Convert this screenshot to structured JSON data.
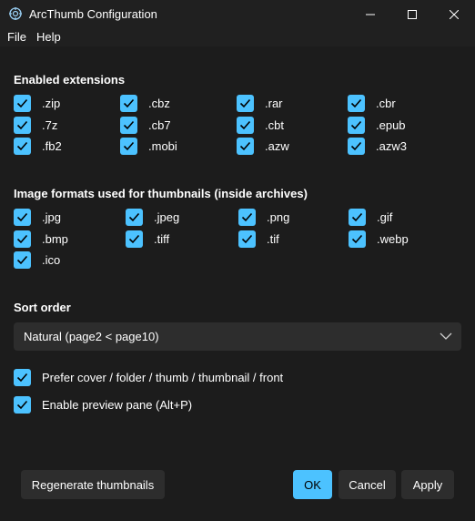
{
  "window": {
    "title": "ArcThumb Configuration",
    "icons": [
      "app-icon",
      "minimize-icon",
      "maximize-icon",
      "close-icon"
    ]
  },
  "menu": {
    "file": "File",
    "help": "Help"
  },
  "extensions": {
    "heading": "Enabled extensions",
    "items": [
      ".zip",
      ".cbz",
      ".rar",
      ".cbr",
      ".7z",
      ".cb7",
      ".cbt",
      ".epub",
      ".fb2",
      ".mobi",
      ".azw",
      ".azw3"
    ],
    "checked": true
  },
  "image_formats": {
    "heading": "Image formats used for thumbnails (inside archives)",
    "items": [
      ".jpg",
      ".jpeg",
      ".png",
      ".gif",
      ".bmp",
      ".tiff",
      ".tif",
      ".webp",
      ".ico"
    ],
    "checked": true
  },
  "sort": {
    "heading": "Sort order",
    "selected": "Natural (page2 < page10)"
  },
  "options": {
    "prefer_cover": "Prefer cover / folder / thumb / thumbnail / front",
    "preview_pane": "Enable preview pane (Alt+P)"
  },
  "buttons": {
    "regenerate": "Regenerate thumbnails",
    "ok": "OK",
    "cancel": "Cancel",
    "apply": "Apply"
  },
  "colors": {
    "accent": "#4cc2ff",
    "background": "#1c1c1c",
    "control": "#2d2d2d"
  }
}
